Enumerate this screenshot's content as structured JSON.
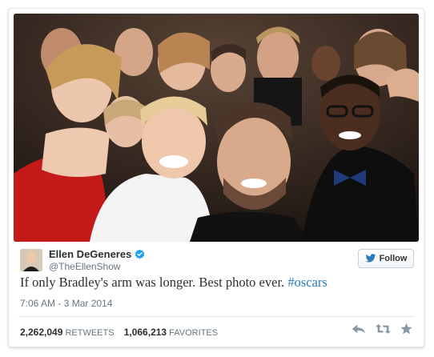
{
  "tweet": {
    "author_name": "Ellen DeGeneres",
    "handle": "@TheEllenShow",
    "follow_label": "Follow",
    "text": "If only Bradley's arm was longer. Best photo ever.",
    "hashtag": "#oscars",
    "timestamp": "7:06 AM - 3 Mar 2014",
    "retweets_count": "2,262,049",
    "retweets_label": "RETWEETS",
    "favorites_count": "1,066,213",
    "favorites_label": "FAVORITES"
  },
  "icons": {
    "verified": "verified-badge-icon",
    "follow": "twitter-bird-icon",
    "reply": "reply-icon",
    "retweet": "retweet-icon",
    "favorite": "star-icon"
  },
  "colors": {
    "link": "#2b7bb9",
    "verified": "#1da1f2",
    "text": "#292f33",
    "muted": "#66757f",
    "action_icons": "#8899a6"
  }
}
